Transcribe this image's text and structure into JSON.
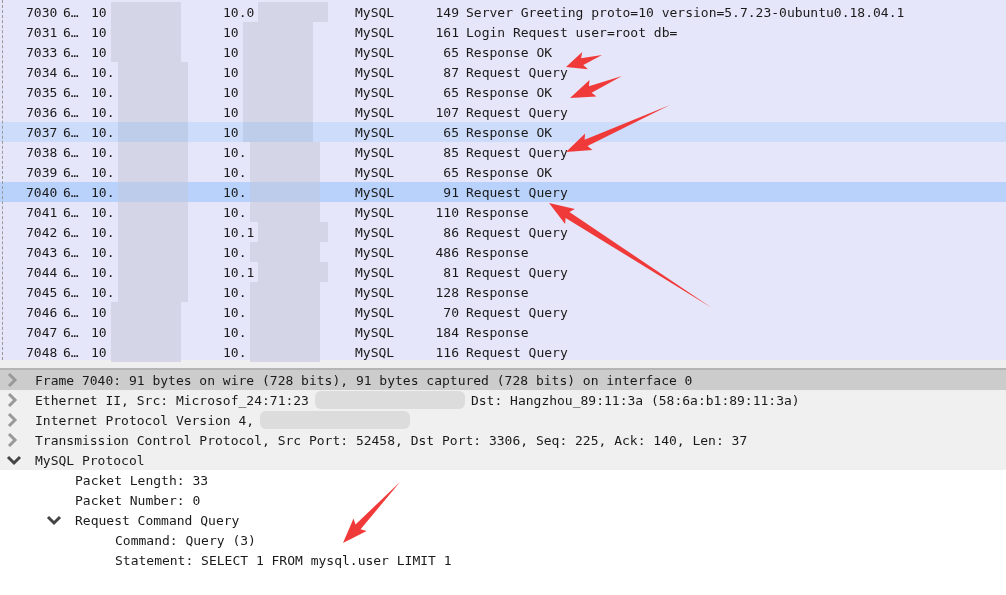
{
  "packets": [
    {
      "no": "7030",
      "time": "6…",
      "source": "10",
      "destination": "10.0",
      "protocol": "MySQL",
      "length": "149",
      "info": "Server Greeting proto=10 version=5.7.23-0ubuntu0.18.04.1",
      "selected": false,
      "highlighted": false
    },
    {
      "no": "7031",
      "time": "6…",
      "source": "10",
      "destination": "10",
      "protocol": "MySQL",
      "length": "161",
      "info": "Login Request user=root db=",
      "selected": false,
      "highlighted": false
    },
    {
      "no": "7033",
      "time": "6…",
      "source": "10",
      "destination": "10",
      "protocol": "MySQL",
      "length": "65",
      "info": "Response OK",
      "selected": false,
      "highlighted": false
    },
    {
      "no": "7034",
      "time": "6…",
      "source": "10.",
      "destination": "10",
      "protocol": "MySQL",
      "length": "87",
      "info": "Request Query",
      "selected": false,
      "highlighted": false
    },
    {
      "no": "7035",
      "time": "6…",
      "source": "10.",
      "destination": "10",
      "protocol": "MySQL",
      "length": "65",
      "info": "Response OK",
      "selected": false,
      "highlighted": false
    },
    {
      "no": "7036",
      "time": "6…",
      "source": "10.",
      "destination": "10",
      "protocol": "MySQL",
      "length": "107",
      "info": "Request Query",
      "selected": false,
      "highlighted": false
    },
    {
      "no": "7037",
      "time": "6…",
      "source": "10.",
      "destination": "10",
      "protocol": "MySQL",
      "length": "65",
      "info": "Response OK",
      "selected": false,
      "highlighted": true
    },
    {
      "no": "7038",
      "time": "6…",
      "source": "10.",
      "destination": "10.",
      "protocol": "MySQL",
      "length": "85",
      "info": "Request Query",
      "selected": false,
      "highlighted": false
    },
    {
      "no": "7039",
      "time": "6…",
      "source": "10.",
      "destination": "10.",
      "protocol": "MySQL",
      "length": "65",
      "info": "Response OK",
      "selected": false,
      "highlighted": false
    },
    {
      "no": "7040",
      "time": "6…",
      "source": "10.",
      "destination": "10.",
      "protocol": "MySQL",
      "length": "91",
      "info": "Request Query",
      "selected": true,
      "highlighted": false
    },
    {
      "no": "7041",
      "time": "6…",
      "source": "10.",
      "destination": "10.",
      "protocol": "MySQL",
      "length": "110",
      "info": "Response",
      "selected": false,
      "highlighted": false
    },
    {
      "no": "7042",
      "time": "6…",
      "source": "10.",
      "destination": "10.1",
      "protocol": "MySQL",
      "length": "86",
      "info": "Request Query",
      "selected": false,
      "highlighted": false
    },
    {
      "no": "7043",
      "time": "6…",
      "source": "10.",
      "destination": "10.",
      "protocol": "MySQL",
      "length": "486",
      "info": "Response",
      "selected": false,
      "highlighted": false
    },
    {
      "no": "7044",
      "time": "6…",
      "source": "10.",
      "destination": "10.1",
      "protocol": "MySQL",
      "length": "81",
      "info": "Request Query",
      "selected": false,
      "highlighted": false
    },
    {
      "no": "7045",
      "time": "6…",
      "source": "10.",
      "destination": "10.",
      "protocol": "MySQL",
      "length": "128",
      "info": "Response",
      "selected": false,
      "highlighted": false
    },
    {
      "no": "7046",
      "time": "6…",
      "source": "10",
      "destination": "10.",
      "protocol": "MySQL",
      "length": "70",
      "info": "Request Query",
      "selected": false,
      "highlighted": false
    },
    {
      "no": "7047",
      "time": "6…",
      "source": "10",
      "destination": "10.",
      "protocol": "MySQL",
      "length": "184",
      "info": "Response",
      "selected": false,
      "highlighted": false
    },
    {
      "no": "7048",
      "time": "6…",
      "source": "10",
      "destination": "10.",
      "protocol": "MySQL",
      "length": "116",
      "info": "Request Query",
      "selected": false,
      "highlighted": false
    }
  ],
  "details": [
    {
      "texts": [
        "Frame 7040: 91 bytes on wire (728 bits), 91 bytes captured (728 bits) on interface 0"
      ],
      "expanded": false,
      "selected": true
    },
    {
      "texts": [
        "Ethernet II, Src: Microsof_24:71:23",
        "Dst: Hangzhou_89:11:3a (58:6a:b1:89:11:3a)"
      ],
      "expanded": false,
      "selected": false
    },
    {
      "texts": [
        "Internet Protocol Version 4,"
      ],
      "expanded": false,
      "selected": false
    },
    {
      "texts": [
        "Transmission Control Protocol, Src Port: 52458, Dst Port: 3306, Seq: 225, Ack: 140, Len: 37"
      ],
      "expanded": false,
      "selected": false
    },
    {
      "texts": [
        "MySQL Protocol"
      ],
      "expanded": true,
      "selected": false,
      "children": [
        {
          "texts": [
            "Packet Length: 33"
          ]
        },
        {
          "texts": [
            "Packet Number: 0"
          ]
        },
        {
          "texts": [
            "Request Command Query"
          ],
          "expanded": true,
          "children": [
            {
              "texts": [
                "Command: Query (3)"
              ]
            },
            {
              "texts": [
                "Statement: SELECT 1 FROM mysql.user LIMIT 1"
              ]
            }
          ]
        }
      ]
    }
  ]
}
